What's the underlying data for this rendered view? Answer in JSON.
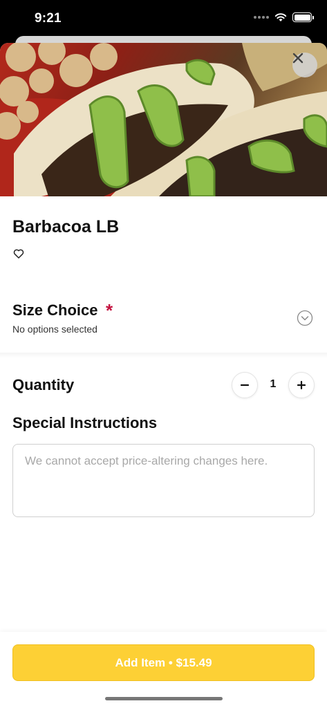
{
  "status_bar": {
    "time": "9:21"
  },
  "item": {
    "title": "Barbacoa LB"
  },
  "size_choice": {
    "title": "Size Choice",
    "required_marker": "*",
    "subtitle": "No options selected"
  },
  "quantity": {
    "label": "Quantity",
    "value": "1",
    "minus": "−",
    "plus": "+"
  },
  "special_instructions": {
    "title": "Special Instructions",
    "placeholder": "We cannot accept price-altering changes here.",
    "value": ""
  },
  "footer": {
    "add_button_label": "Add Item • $15.49"
  },
  "colors": {
    "accent": "#fdd035",
    "required": "#c4123f"
  },
  "icons": [
    "wifi-icon",
    "battery-icon",
    "close-icon",
    "heart-icon",
    "chevron-down-icon",
    "minus-icon",
    "plus-icon"
  ]
}
